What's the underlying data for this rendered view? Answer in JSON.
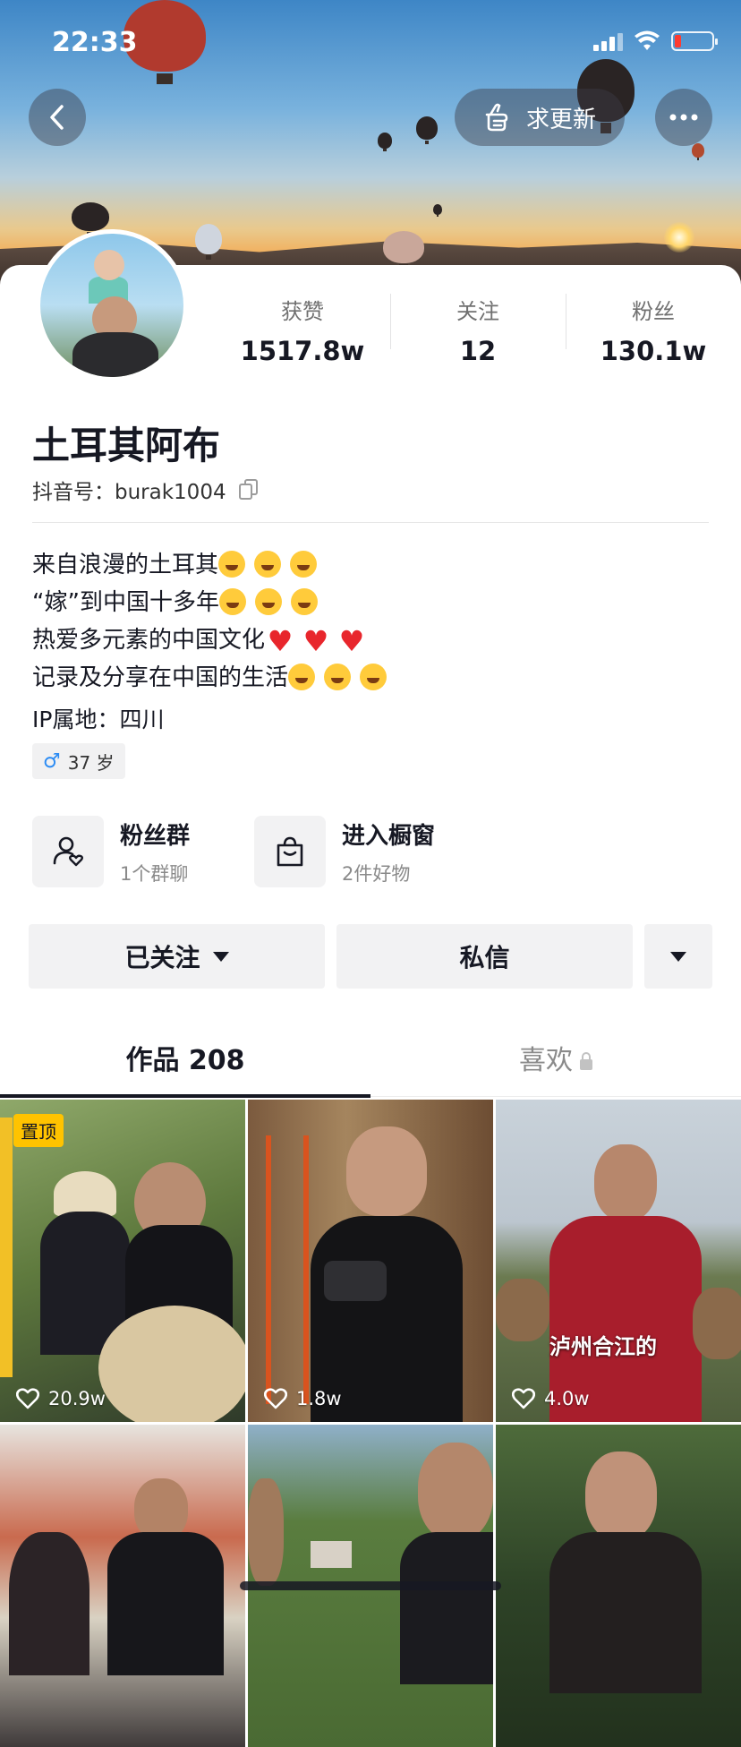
{
  "status_bar": {
    "time": "22:33"
  },
  "header": {
    "request_update_label": "求更新"
  },
  "profile": {
    "name": "土耳其阿布",
    "id_label": "抖音号：",
    "id_value": "burak1004",
    "stats": [
      {
        "label": "获赞",
        "value": "1517.8w"
      },
      {
        "label": "关注",
        "value": "12"
      },
      {
        "label": "粉丝",
        "value": "130.1w"
      }
    ],
    "bio": [
      {
        "text": "来自浪漫的土耳其",
        "emoji": "rolling-laughing",
        "count": 3
      },
      {
        "text": "“嫁”到中国十多年",
        "emoji": "grinning",
        "count": 3
      },
      {
        "text": "热爱多元素的中国文化",
        "emoji": "red-heart",
        "count": 3
      },
      {
        "text": "记录及分享在中国的生活",
        "emoji": "smiling",
        "count": 3
      }
    ],
    "ip_location": "IP属地：四川",
    "age": "37 岁"
  },
  "features": {
    "fan_group": {
      "title": "粉丝群",
      "sub": "1个群聊"
    },
    "shop": {
      "title": "进入橱窗",
      "sub": "2件好物"
    }
  },
  "actions": {
    "following_label": "已关注",
    "message_label": "私信"
  },
  "tabs": {
    "works_label": "作品 208",
    "likes_label": "喜欢"
  },
  "videos": [
    {
      "likes": "20.9w",
      "pinned": "置顶"
    },
    {
      "likes": "1.8w"
    },
    {
      "likes": "4.0w",
      "caption": "泸州合江的"
    },
    {},
    {},
    {}
  ],
  "colors": {
    "accent_red": "#e8262c",
    "pin_yellow": "#ffc300",
    "male_blue": "#2c8cf4"
  }
}
